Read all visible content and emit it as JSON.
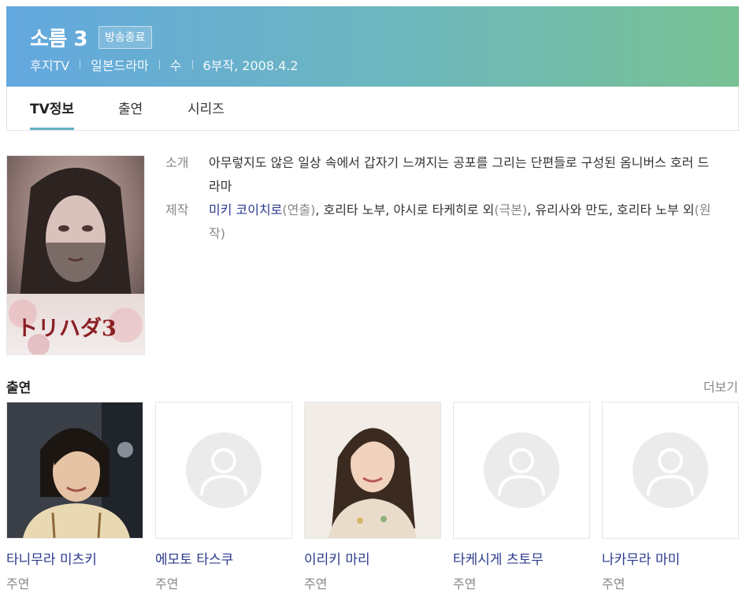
{
  "header": {
    "title": "소름 3",
    "badge": "방송종료",
    "meta": [
      "후지TV",
      "일본드라마",
      "수",
      "6부작, 2008.4.2"
    ]
  },
  "tabs": [
    "TV정보",
    "출연",
    "시리즈"
  ],
  "poster": {
    "logo_text": "トリハダ3"
  },
  "info": {
    "intro_label": "소개",
    "intro_text": "아무렇지도 않은 일상 속에서 갑자기 느껴지는 공포를 그리는 단편들로 구성된 옴니버스 호러 드라마",
    "prod_label": "제작",
    "prod": {
      "director": "미키 코이치로",
      "director_role": "(연출)",
      "writers": ", 호리타 노부, 야시로 타케히로 외",
      "writers_role": "(극본)",
      "original": ", 유리사와 만도, 호리타 노부 외",
      "original_role": "(원작)"
    }
  },
  "cast_section": {
    "title": "출연",
    "more": "더보기",
    "members": [
      {
        "name": "타니무라 미츠키",
        "role": "주연",
        "photo": "photo"
      },
      {
        "name": "에모토 타스쿠",
        "role": "주연",
        "photo": "placeholder"
      },
      {
        "name": "이리키 마리",
        "role": "주연",
        "photo": "photo"
      },
      {
        "name": "타케시게 츠토무",
        "role": "주연",
        "photo": "placeholder"
      },
      {
        "name": "나카무라 마미",
        "role": "주연",
        "photo": "placeholder"
      }
    ]
  }
}
